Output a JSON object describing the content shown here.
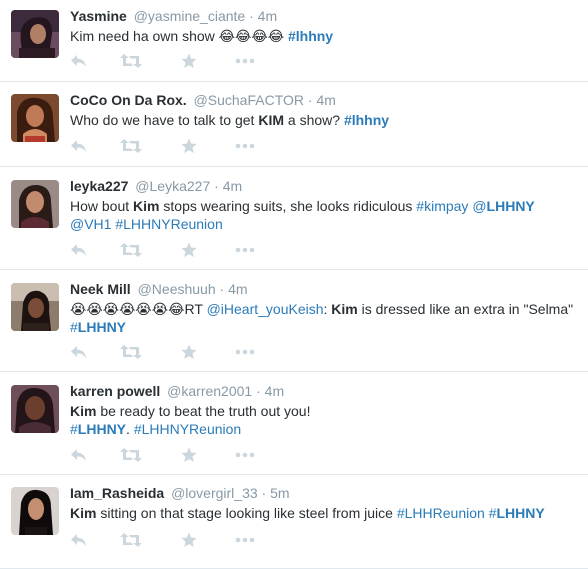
{
  "tweets": [
    {
      "name": "Yasmine",
      "handle": "@yasmine_ciante",
      "sep": "·",
      "time": "4m",
      "parts": [
        {
          "t": "Kim need ha own show 😂😂😂😂 "
        },
        {
          "t": "#lhhny",
          "c": "tag",
          "b": true
        }
      ]
    },
    {
      "name": "CoCo On Da Rox.",
      "handle": "@SuchaFACTOR",
      "sep": "·",
      "time": "4m",
      "parts": [
        {
          "t": "Who do we have to talk to get "
        },
        {
          "t": "KIM",
          "b": true
        },
        {
          "t": " a show? "
        },
        {
          "t": "#lhhny",
          "c": "tag",
          "b": true
        }
      ]
    },
    {
      "name": "leyka227",
      "handle": "@Leyka227",
      "sep": "·",
      "time": "4m",
      "parts": [
        {
          "t": "How bout "
        },
        {
          "t": "Kim",
          "b": true
        },
        {
          "t": " stops wearing suits, she looks ridiculous "
        },
        {
          "t": "#kimpay",
          "c": "tag"
        },
        {
          "t": " "
        },
        {
          "t": "@",
          "c": "mention"
        },
        {
          "t": "LHHNY",
          "c": "mention",
          "b": true
        },
        {
          "t": " "
        },
        {
          "t": "@VH1",
          "c": "mention"
        },
        {
          "t": " "
        },
        {
          "t": "#LHHNYReunion",
          "c": "tag"
        }
      ]
    },
    {
      "name": "Neek Mill",
      "handle": "@Neeshuuh",
      "sep": "·",
      "time": "4m",
      "parts": [
        {
          "t": "😭😭😭😭😭😭😂RT "
        },
        {
          "t": "@iHeart_youKeish",
          "c": "mention"
        },
        {
          "t": ": "
        },
        {
          "t": "Kim",
          "b": true
        },
        {
          "t": " is dressed like an extra in \"Selma\" "
        },
        {
          "t": "#",
          "c": "tag"
        },
        {
          "t": "LHHNY",
          "c": "tag",
          "b": true
        }
      ]
    },
    {
      "name": "karren powell",
      "handle": "@karren2001",
      "sep": "·",
      "time": "4m",
      "parts": [
        {
          "t": "Kim",
          "b": true
        },
        {
          "t": " be ready to beat the truth out you!"
        },
        {
          "br": true
        },
        {
          "t": "#",
          "c": "tag"
        },
        {
          "t": "LHHNY",
          "c": "tag",
          "b": true
        },
        {
          "t": ". "
        },
        {
          "t": "#LHHNYReunion",
          "c": "tag"
        }
      ]
    },
    {
      "name": "Iam_Rasheida",
      "handle": "@lovergirl_33",
      "sep": "·",
      "time": "5m",
      "parts": [
        {
          "t": "Kim",
          "b": true
        },
        {
          "t": " sitting on that stage looking like steel from juice "
        },
        {
          "t": "#LHHReunion",
          "c": "tag"
        },
        {
          "t": " "
        },
        {
          "t": "#",
          "c": "tag"
        },
        {
          "t": "LHHNY",
          "c": "tag",
          "b": true
        }
      ]
    }
  ],
  "actions": [
    "reply-icon",
    "retweet-icon",
    "favorite-icon",
    "more-icon"
  ],
  "colors": {
    "link": "#2b7bb9",
    "muted": "#8899a6",
    "icon": "#ccd6dd",
    "divider": "#e1e8ed"
  }
}
